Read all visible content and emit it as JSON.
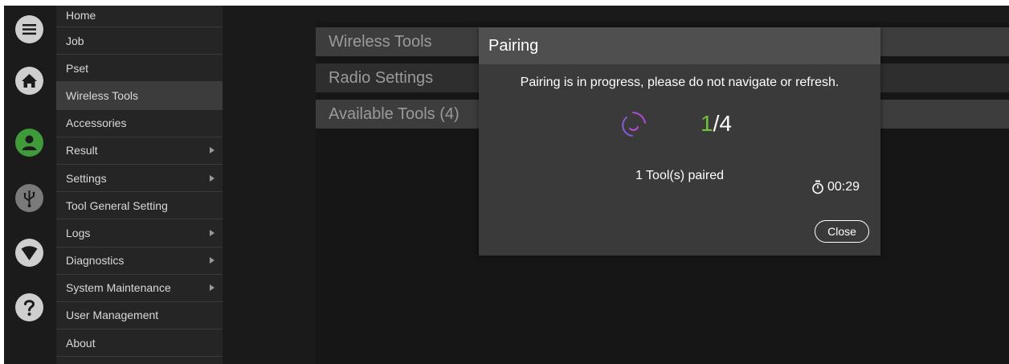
{
  "menu": {
    "items": [
      {
        "label": "Home",
        "has_submenu": false
      },
      {
        "label": "Job",
        "has_submenu": false
      },
      {
        "label": "Pset",
        "has_submenu": false
      },
      {
        "label": "Wireless Tools",
        "has_submenu": false,
        "active": true
      },
      {
        "label": "Accessories",
        "has_submenu": false
      },
      {
        "label": "Result",
        "has_submenu": true
      },
      {
        "label": "Settings",
        "has_submenu": true
      },
      {
        "label": "Tool General Setting",
        "has_submenu": false
      },
      {
        "label": "Logs",
        "has_submenu": true
      },
      {
        "label": "Diagnostics",
        "has_submenu": true
      },
      {
        "label": "System Maintenance",
        "has_submenu": true
      },
      {
        "label": "User Management",
        "has_submenu": false
      },
      {
        "label": "About",
        "has_submenu": false
      }
    ]
  },
  "iconbar": {
    "icons": [
      "menu-icon",
      "home-icon",
      "user-icon",
      "usb-icon",
      "wifi-icon",
      "help-icon"
    ],
    "user_color": "#3f9b3a"
  },
  "content": {
    "rows": [
      "Wireless Tools",
      "Radio Settings",
      "Available Tools (4)"
    ]
  },
  "dialog": {
    "title": "Pairing",
    "message": "Pairing is in progress, please do not navigate or refresh.",
    "paired_count": "1",
    "total_sep": "/4",
    "paired_text": "1 Tool(s) paired",
    "timer_icon": "stopwatch-icon",
    "timer": "00:29",
    "close_label": "Close",
    "count_color": "#72c23b",
    "spinner_color": "#b04ad8"
  }
}
